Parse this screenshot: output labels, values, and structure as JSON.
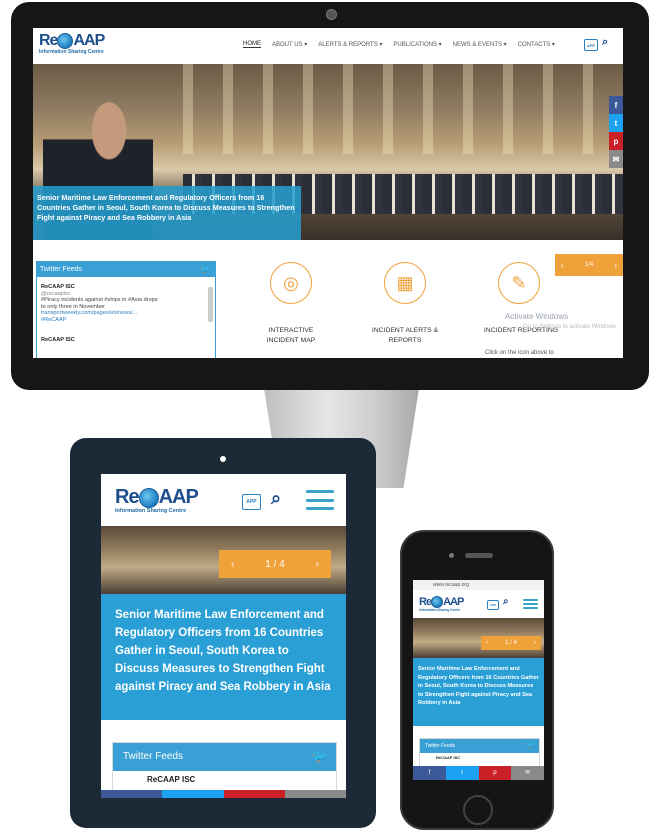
{
  "brand": {
    "logo_pre": "Re",
    "logo_post": "AAP",
    "tagline": "Information Sharing Centre",
    "colors": {
      "primary": "#39a0d6",
      "accent": "#f0a23a",
      "dark": "#1f4f8c"
    }
  },
  "desktop": {
    "nav": [
      "HOME",
      "ABOUT US ▾",
      "ALERTS & REPORTS ▾",
      "PUBLICATIONS ▾",
      "NEWS & EVENTS ▾",
      "CONTACTS ▾"
    ],
    "app_label": "APP",
    "hero_caption": "Senior Maritime Law Enforcement and Regulatory Officers from 16 Countries Gather in Seoul, South Korea to Discuss Measures to Strengthen Fight against Piracy and Sea Robbery in Asia",
    "slider": {
      "prev": "‹",
      "counter": "1/4",
      "next": "›"
    },
    "social": [
      "f",
      "t",
      "p",
      "✉"
    ],
    "twitter": {
      "title": "Twitter Feeds",
      "account": "ReCAAP ISC",
      "handle": "@recaapisc",
      "tweet_1": "#Piracy incidents against #ships in #Asia drops",
      "tweet_2": "to only three in November",
      "link": "transportweekly.com/pages/en/news/...",
      "hashtag": "#ReCAAP",
      "account_2": "ReCAAP ISC"
    },
    "services": [
      {
        "line1": "INTERACTIVE",
        "line2": "INCIDENT MAP",
        "icon": "globe-map-icon"
      },
      {
        "line1": "INCIDENT ALERTS &",
        "line2": "REPORTS",
        "icon": "alerts-icon"
      },
      {
        "line1": "INCIDENT REPORTING",
        "line2": "",
        "icon": "reporting-icon"
      }
    ],
    "report_hint": "Click on the icon above to",
    "watermark_1": "Activate Windows",
    "watermark_2": "Go to Settings to activate Windows"
  },
  "tablet": {
    "app_label": "APP",
    "slider": {
      "prev": "‹",
      "counter": "1 / 4",
      "next": "›"
    },
    "hero_caption": "Senior Maritime Law Enforcement and Regulatory Officers from 16 Countries Gather in Seoul, South Korea to Discuss Measures to Strengthen Fight against Piracy and Sea Robbery in Asia",
    "twitter_title": "Twitter Feeds",
    "account": "ReCAAP ISC"
  },
  "phone": {
    "url": "www.recaap.org",
    "app_label": "APP",
    "slider": {
      "prev": "‹",
      "counter": "1 / 4",
      "next": "›"
    },
    "hero_caption": "Senior Maritime Law Enforcement and Regulatory Officers from 16 Countries Gather in Seoul, South Korea to Discuss Measures to Strengthen Fight against Piracy and Sea Robbery in Asia",
    "twitter_title": "Twitter Feeds",
    "account": "ReCAAP ISC",
    "social": [
      "f",
      "t",
      "p",
      "✉"
    ]
  }
}
